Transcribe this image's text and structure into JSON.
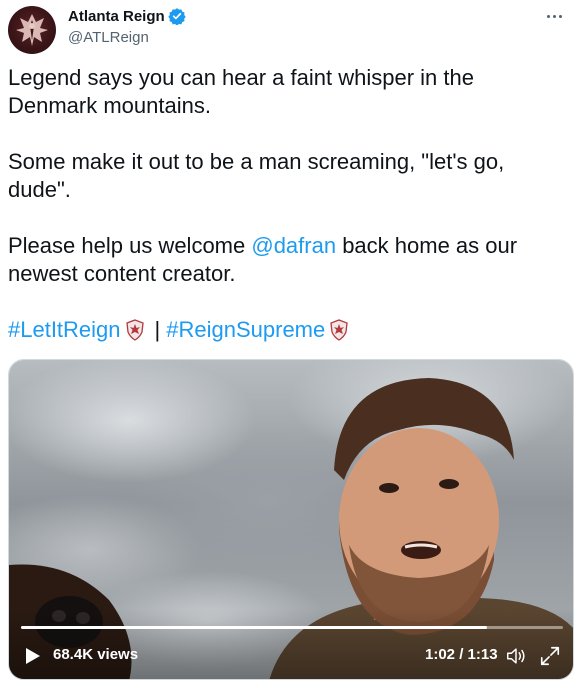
{
  "author": {
    "display_name": "Atlanta Reign",
    "handle": "@ATLReign",
    "verified": true
  },
  "tweet": {
    "p1": "Legend says you can hear a faint whisper in the Denmark mountains.",
    "p2": "Some make it out to be a man screaming, \"let's go, dude\".",
    "p3_before": "Please help us welcome ",
    "p3_mention": "@dafran",
    "p3_after": " back home as our newest content creator.",
    "hashtag1": "#LetItReign",
    "separator": "|",
    "hashtag2": "#ReignSupreme"
  },
  "video": {
    "views": "68.4K views",
    "time": "1:02 / 1:13",
    "progress": 0.86
  },
  "icons": {
    "more": "more-icon",
    "verified": "verified-badge-icon",
    "play": "play-icon",
    "volume": "volume-icon",
    "fullscreen": "fullscreen-icon",
    "crest": "reign-crest-emoji"
  },
  "colors": {
    "link": "#1d9bf0",
    "text": "#0f1419",
    "secondary": "#536471",
    "brand": "#5a2326"
  }
}
